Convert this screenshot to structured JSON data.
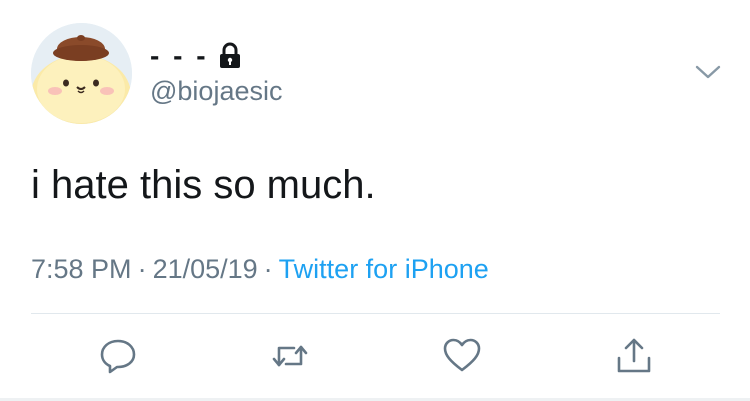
{
  "user": {
    "display_name": "- - -",
    "handle": "@biojaesic",
    "avatar_icon": "avatar-image",
    "protected_icon": "lock-icon"
  },
  "tweet": {
    "text": "i hate this so much.",
    "time": "7:58 PM",
    "date": "21/05/19",
    "separator": "·",
    "source": "Twitter for iPhone"
  },
  "actions": {
    "reply_icon": "reply-icon",
    "retweet_icon": "retweet-icon",
    "like_icon": "like-icon",
    "share_icon": "share-icon"
  },
  "menu": {
    "icon": "chevron-down-icon"
  },
  "colors": {
    "text": "#14171a",
    "secondary": "#657786",
    "link": "#1da1f2",
    "divider": "#e1e8ed"
  }
}
